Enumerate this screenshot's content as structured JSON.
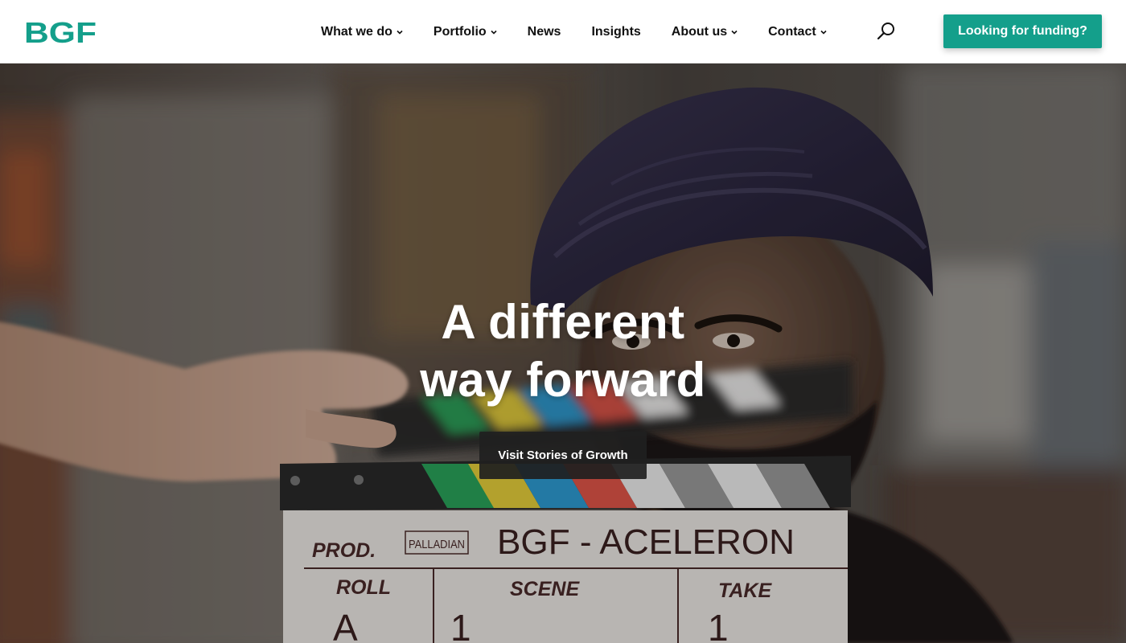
{
  "header": {
    "logo_text": "BGF",
    "brand_color": "#149f8b",
    "nav": [
      {
        "label": "What we do",
        "has_dropdown": true
      },
      {
        "label": "Portfolio",
        "has_dropdown": true
      },
      {
        "label": "News",
        "has_dropdown": false
      },
      {
        "label": "Insights",
        "has_dropdown": false
      },
      {
        "label": "About us",
        "has_dropdown": true
      },
      {
        "label": "Contact",
        "has_dropdown": true
      }
    ],
    "search_icon": "search-icon",
    "cta_label": "Looking for funding?",
    "cta_color": "#149f8b"
  },
  "hero": {
    "title_line1": "A different",
    "title_line2": "way forward",
    "button_label": "Visit Stories of Growth",
    "clapper": {
      "prod_label": "PROD.",
      "stamp": "PALLADIAN",
      "prod_value": "BGF - ACELERON",
      "roll_label": "ROLL",
      "scene_label": "SCENE",
      "take_label": "TAKE",
      "roll_value": "A",
      "scene_value": "1",
      "take_value": "1"
    }
  }
}
